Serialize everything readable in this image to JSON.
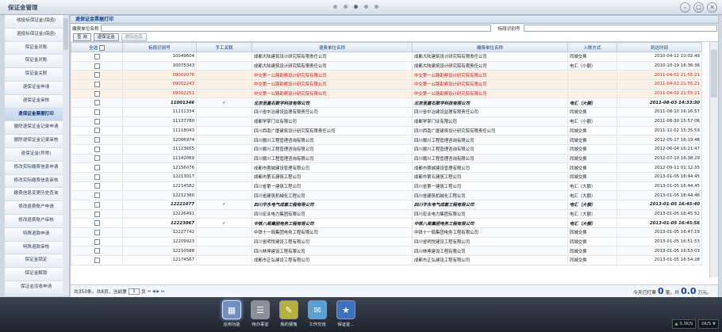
{
  "window": {
    "title": "保证金管理"
  },
  "sidebar": {
    "items": [
      {
        "label": "收投标保证金(保函)"
      },
      {
        "label": "退投标保证金(保函)"
      },
      {
        "label": "保证金对账"
      },
      {
        "label": "保证金对账"
      },
      {
        "label": "保证金关联"
      },
      {
        "label": "退保证金申请"
      },
      {
        "label": "退保证金审核"
      },
      {
        "label": "退保证金票据打印",
        "active": true
      },
      {
        "label": "撤除退保证金记录申请"
      },
      {
        "label": "撤除退保证金记录审核"
      },
      {
        "label": "退保证金(异常)"
      },
      {
        "label": "修改实际缴费信息申请"
      },
      {
        "label": "修改实际缴费信息审核"
      },
      {
        "label": "缴费信息变更历史查询"
      },
      {
        "label": "修改退费账户申请"
      },
      {
        "label": "修改退费账户审核"
      },
      {
        "label": "特殊退款申请"
      },
      {
        "label": "特殊退款审核"
      },
      {
        "label": "保证金锁定"
      },
      {
        "label": "保证金解锁"
      },
      {
        "label": "保证金没收申请"
      },
      {
        "label": "保证金没收复核"
      }
    ]
  },
  "panel": {
    "title": "退保证金票据打印"
  },
  "filters": {
    "payer_label": "缴费单位名称",
    "bid_label": "标段识别号"
  },
  "toolbar": {
    "query": "查 询",
    "refund": "退保证金",
    "delete": "删除信息"
  },
  "table": {
    "headers": [
      "全选",
      "标段识别号",
      "手工关联",
      "退费单位名称",
      "缴费单位名称",
      "入账方式",
      "到达时间"
    ],
    "rows": [
      {
        "id": "10049604",
        "manual": "",
        "refund": "成都大陆建筑设计研究院有限责任公司",
        "payer": "成都大陆建筑设计研究院有限责任公司",
        "method": "同城交换",
        "time": "2010-04-12 10:02:49",
        "style": ""
      },
      {
        "id": "10075343",
        "manual": "",
        "refund": "成都大陆建筑设计研究院有限责任公司",
        "payer": "成都大陆建筑设计研究院有限责任公司",
        "method": "电汇（小额）",
        "time": "2010-10-19 16:36:36",
        "style": ""
      },
      {
        "id": "09002076",
        "manual": "",
        "refund": "中交第一公路勘察设计研究院有限公司",
        "payer": "中交第一公路勘察设计研究院有限公司",
        "method": "",
        "time": "2011-04-02 21:55:21",
        "style": "red"
      },
      {
        "id": "09002243",
        "manual": "",
        "refund": "中交第一公路勘察设计研究院有限公司",
        "payer": "中交第一公路勘察设计研究院有限公司",
        "method": "",
        "time": "2011-04-02 21:55:21",
        "style": "red"
      },
      {
        "id": "09002251",
        "manual": "",
        "refund": "中交第一公路勘察设计研究院有限公司",
        "payer": "中交第一公路勘察设计研究院有限公司",
        "method": "",
        "time": "2011-04-02 21:55:21",
        "style": "red"
      },
      {
        "id": "11001346",
        "manual": "✓",
        "refund": "北京圣嘉石数字科技有限公司",
        "payer": "北京圣嘉石数字科技有限公司",
        "method": "电汇（大额）",
        "time": "2011-08-03 14:33:30",
        "style": "bold"
      },
      {
        "id": "11111334",
        "manual": "",
        "refund": "四川省中冶建设监理有限责任公司",
        "payer": "四川省中冶建设监理有限责任公司",
        "method": "同城交换",
        "time": "2011-08-10 16:16:57",
        "style": ""
      },
      {
        "id": "11137780",
        "manual": "",
        "refund": "成都学掌门业有限公司",
        "payer": "成都学掌门业有限公司",
        "method": "电汇（小额）",
        "time": "2011-08-30 15:57:06",
        "style": ""
      },
      {
        "id": "11118043",
        "manual": "",
        "refund": "四川西南广厦建筑设计研究院有限责任公司",
        "payer": "四川西南广厦建筑设计研究院有限责任公司",
        "method": "同城交换",
        "time": "2011-12-02 15:35:59",
        "style": ""
      },
      {
        "id": "12006974",
        "manual": "",
        "refund": "四川顺川工程管理咨询有限公司",
        "payer": "四川顺川工程管理咨询有限公司",
        "method": "同城交换",
        "time": "2012-05-17 16:19:48",
        "style": ""
      },
      {
        "id": "11123665",
        "manual": "",
        "refund": "四川顺川工程管理咨询有限公司",
        "payer": "四川顺川工程管理咨询有限公司",
        "method": "同城交换",
        "time": "2012-06-04 16:21:47",
        "style": ""
      },
      {
        "id": "11142069",
        "manual": "",
        "refund": "四川顺川工程管理咨询有限公司",
        "payer": "四川顺川工程管理咨询有限公司",
        "method": "同城交换",
        "time": "2012-07-10 16:38:29",
        "style": ""
      },
      {
        "id": "12156076",
        "manual": "",
        "refund": "成都市蓉城建设管理有限公司",
        "payer": "成都市蓉城建设管理有限公司",
        "method": "同城交换",
        "time": "2012-09-11 01:12:35",
        "style": ""
      },
      {
        "id": "12213017",
        "manual": "",
        "refund": "成都市第五建筑工程公司",
        "payer": "成都市第五建筑工程公司",
        "method": "同城交换",
        "time": "2013-01-05 16:44:45",
        "style": ""
      },
      {
        "id": "12214582",
        "manual": "",
        "refund": "四川省第一建筑工程公司",
        "payer": "四川省第一建筑工程公司",
        "method": "电汇（大额）",
        "time": "2013-01-05 16:44:45",
        "style": ""
      },
      {
        "id": "12212360",
        "manual": "",
        "refund": "四川省建筑机械化工程公司",
        "payer": "四川省建筑机械化工程公司",
        "method": "电汇（大额）",
        "time": "2013-01-05 16:44:46",
        "style": ""
      },
      {
        "id": "12221077",
        "manual": "✓",
        "refund": "四川华东电气成套工程有限公司",
        "payer": "四川华东电气成套工程有限公司",
        "method": "电汇（大额）",
        "time": "2013-01-05 16:45:40",
        "style": "bold"
      },
      {
        "id": "12226491",
        "manual": "",
        "refund": "四川宏业电力集团有限公司",
        "payer": "四川宏业电力集团有限公司",
        "method": "电汇（大额）",
        "time": "2013-01-05 16:45:52",
        "style": ""
      },
      {
        "id": "12223067",
        "manual": "✓",
        "refund": "中铁八局集团电务工程有限公司",
        "payer": "中铁八局集团电务工程有限公司",
        "method": "电汇（大额）",
        "time": "2013-01-05 16:45:56",
        "style": "bold"
      },
      {
        "id": "12227742",
        "manual": "",
        "refund": "中铁十一局集团电务工程有限公司",
        "payer": "中铁十一局集团电务工程有限公司",
        "method": "同城交换",
        "time": "2013-01-05 16:47:19",
        "style": ""
      },
      {
        "id": "12209923",
        "manual": "",
        "refund": "四川省明悦建设工程有限公司",
        "payer": "四川省明悦建设工程有限公司",
        "method": "同城交换",
        "time": "2013-01-05 16:51:53",
        "style": ""
      },
      {
        "id": "12210588",
        "manual": "",
        "refund": "四川林坤建设工程有限公司",
        "payer": "四川林坤建设工程有限公司",
        "method": "同城交换",
        "time": "2013-01-05 16:53:03",
        "style": ""
      },
      {
        "id": "12174567",
        "manual": "",
        "refund": "成都市正弘建设工程有限公司",
        "payer": "成都市正弘建设工程有限公司",
        "method": "同城交换",
        "time": "2013-01-05 16:54:28",
        "style": ""
      }
    ]
  },
  "pager": {
    "summary": "共353条，共8页，当前第",
    "current_page": "1",
    "suffix": "页",
    "nav": "⏮ ◀ ▶ ⏭"
  },
  "summary": {
    "prefix": "今天已打票",
    "count": "0",
    "unit": "笔，共",
    "amount": "0.0",
    "currency": "万元。"
  },
  "dock": {
    "items": [
      {
        "label": "应用功能",
        "icon": "▦",
        "color": "#6f8fbf",
        "active": true
      },
      {
        "label": "待办事宜",
        "icon": "☰",
        "color": "#8a8f99",
        "active": false
      },
      {
        "label": "我的便笺",
        "icon": "✎",
        "color": "#b7b13a",
        "active": false
      },
      {
        "label": "工作交流",
        "icon": "✉",
        "color": "#5aa0d8",
        "active": false
      },
      {
        "label": "保证金...",
        "icon": "★",
        "color": "#3d6fc2",
        "active": false
      }
    ]
  },
  "tray": {
    "net_up": "0.3K/S",
    "net_down": "0K/S"
  }
}
